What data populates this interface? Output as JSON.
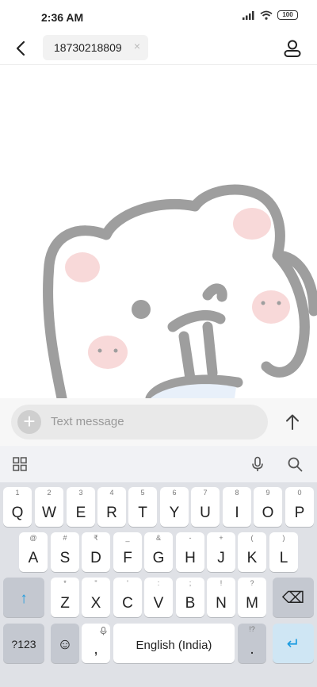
{
  "status_bar": {
    "time": "2:36 AM",
    "battery": "100"
  },
  "header": {
    "recipient": "18730218809",
    "chip_close": "×"
  },
  "compose": {
    "add": "+",
    "placeholder": "Text message"
  },
  "keyboard": {
    "row1": [
      {
        "main": "Q",
        "hint": "1"
      },
      {
        "main": "W",
        "hint": "2"
      },
      {
        "main": "E",
        "hint": "3"
      },
      {
        "main": "R",
        "hint": "4"
      },
      {
        "main": "T",
        "hint": "5"
      },
      {
        "main": "Y",
        "hint": "6"
      },
      {
        "main": "U",
        "hint": "7"
      },
      {
        "main": "I",
        "hint": "8"
      },
      {
        "main": "O",
        "hint": "9"
      },
      {
        "main": "P",
        "hint": "0"
      }
    ],
    "row2": [
      {
        "main": "A",
        "hint": "@"
      },
      {
        "main": "S",
        "hint": "#"
      },
      {
        "main": "D",
        "hint": "₹"
      },
      {
        "main": "F",
        "hint": "_"
      },
      {
        "main": "G",
        "hint": "&"
      },
      {
        "main": "H",
        "hint": "-"
      },
      {
        "main": "J",
        "hint": "+"
      },
      {
        "main": "K",
        "hint": "("
      },
      {
        "main": "L",
        "hint": ")"
      }
    ],
    "row3": [
      {
        "main": "Z",
        "hint": "*"
      },
      {
        "main": "X",
        "hint": "\""
      },
      {
        "main": "C",
        "hint": "'"
      },
      {
        "main": "V",
        "hint": ":"
      },
      {
        "main": "B",
        "hint": ";"
      },
      {
        "main": "N",
        "hint": "!"
      },
      {
        "main": "M",
        "hint": "?"
      }
    ],
    "symbols": "?123",
    "emoji": "☺",
    "comma": ",",
    "space": "English (India)",
    "period": ".",
    "period_hint": "!?",
    "enter": "↵",
    "shift": "↑",
    "backspace": "⌫"
  },
  "colors": {
    "accent": "#1a9be0",
    "keyboard_bg": "#dfe1e6",
    "wallpaper_stroke": "#9e9e9e",
    "wallpaper_blush": "#f8d9d9"
  },
  "icons": {
    "back": "back-arrow-icon",
    "contact": "person-icon",
    "send": "send-arrow-icon",
    "apps": "grid-icon",
    "mic": "microphone-icon",
    "search": "search-icon"
  }
}
